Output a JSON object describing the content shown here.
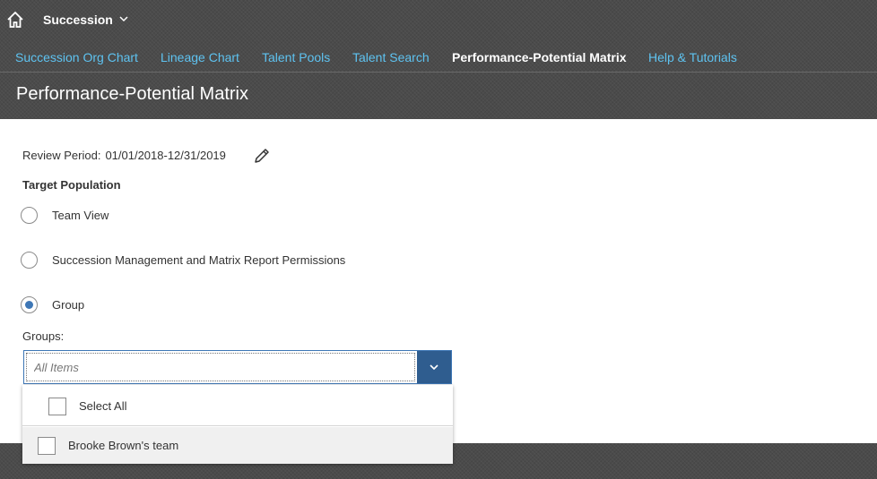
{
  "header": {
    "app_title": "Succession",
    "icons": {
      "home": "home-icon",
      "app_menu": "chevron-down-icon"
    }
  },
  "nav": {
    "tabs": [
      {
        "label": "Succession Org Chart",
        "active": false
      },
      {
        "label": "Lineage Chart",
        "active": false
      },
      {
        "label": "Talent Pools",
        "active": false
      },
      {
        "label": "Talent Search",
        "active": false
      },
      {
        "label": "Performance-Potential Matrix",
        "active": true
      },
      {
        "label": "Help & Tutorials",
        "active": false
      }
    ],
    "link_color": "#5ec3f1"
  },
  "page": {
    "title": "Performance-Potential Matrix"
  },
  "review": {
    "label": "Review Period:",
    "value": "01/01/2018-12/31/2019",
    "edit_icon": "pencil-icon"
  },
  "target_population": {
    "label": "Target Population",
    "options": [
      {
        "label": "Team View",
        "selected": false
      },
      {
        "label": "Succession Management and Matrix Report Permissions",
        "selected": false
      },
      {
        "label": "Group",
        "selected": true
      }
    ]
  },
  "groups": {
    "label": "Groups:",
    "placeholder": "All Items",
    "dropdown_icon": "chevron-down-icon",
    "options": [
      {
        "label": "Select All",
        "checked": false
      },
      {
        "label": "Brooke Brown's team",
        "checked": false
      }
    ]
  },
  "colors": {
    "accent": "#3e77b6",
    "combo_button": "#2f5d8f"
  }
}
